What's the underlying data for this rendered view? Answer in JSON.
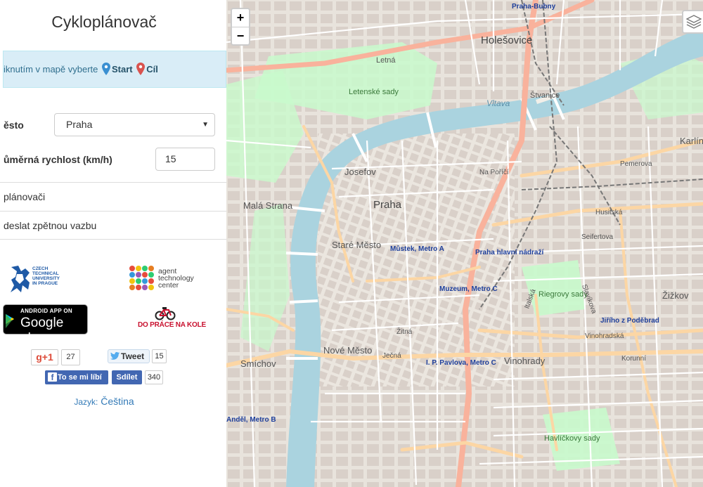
{
  "app": {
    "title": "Cykloplánovač"
  },
  "hint": {
    "prefix": "iknutím v mapě vyberte",
    "start": "Start",
    "end": "Cíl"
  },
  "form": {
    "city_label": "ěsto",
    "city_value": "Praha",
    "speed_label": "ůměrná rychlost (km/h)",
    "speed_value": "15"
  },
  "menu": {
    "about": "plánovači",
    "feedback": "deslat zpětnou vazbu"
  },
  "logos": {
    "cvut_text": [
      "CZECH",
      "TECHNICAL",
      "UNIVERSITY",
      "IN PRAGUE"
    ],
    "atc_text": [
      "agent",
      "technology",
      "center"
    ],
    "gplay_small": "ANDROID APP ON",
    "gplay_big": "Google play",
    "dpnk": "DO PRÁCE NA KOLE"
  },
  "social": {
    "gplus_label": "g+1",
    "gplus_count": "27",
    "tweet_label": "Tweet",
    "tweet_count": "15",
    "fb_like": "To se mi líbí",
    "fb_share": "Sdílet",
    "fb_count": "340"
  },
  "language": {
    "label": "Jazyk:",
    "value": "Čeština"
  },
  "map": {
    "zoom_in": "+",
    "zoom_out": "−",
    "districts": [
      "Holešovice",
      "Praha",
      "Josefov",
      "Malá Strana",
      "Staré Město",
      "Nové Město",
      "Smíchov",
      "Vinohrady",
      "Žižkov",
      "Karlín",
      "Letná",
      "Štvanice"
    ],
    "places": [
      "Letenské sady",
      "Riegrovy sady",
      "Havlíčkovy sady",
      "Vltava",
      "Na Poříčí",
      "Pemerova"
    ],
    "stations": [
      "Praha-Bubny",
      "Můstek, Metro A",
      "Praha hlavní nádraží",
      "Muzeum, Metro C",
      "I. P. Pavlova, Metro C",
      "Jiřího z Poděbrad",
      "Anděl, Metro B"
    ],
    "streets": [
      "Vinohradská",
      "Korunní",
      "Seifertova",
      "Husitská",
      "Žitná",
      "Ječná",
      "Italská",
      "Slavíkova"
    ]
  },
  "colors": {
    "water": "#aad3df",
    "park": "#c8facc",
    "primary_road": "#fcd6a4",
    "trunk": "#f9b29c",
    "rail": "#777777",
    "accent": "#337ab7"
  }
}
